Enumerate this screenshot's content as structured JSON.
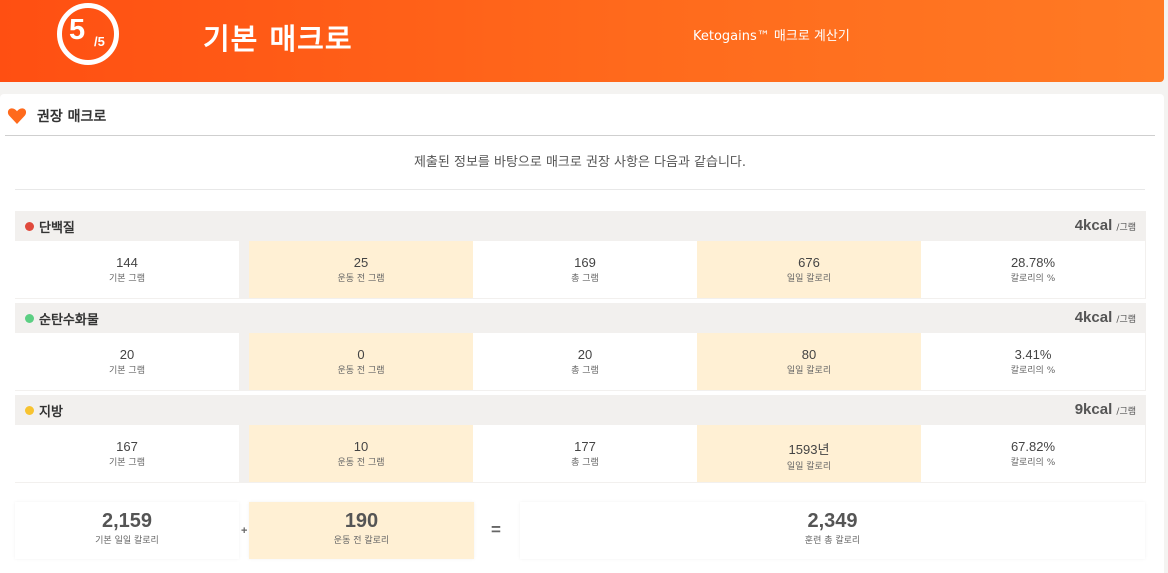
{
  "header": {
    "step_current": "5",
    "step_total": "/5",
    "title": "기본 매크로",
    "subtitle": "Ketogains™ 매크로 계산기",
    "gradient_colors": [
      "#ff4f12",
      "#ff7a24"
    ]
  },
  "section": {
    "icon": "heart-icon",
    "title": "권장 매크로",
    "intro": "제출된 정보를 바탕으로 매크로 권장 사항은 다음과 같습니다."
  },
  "groups": [
    {
      "name": "단백질",
      "color": "#e04a3c",
      "kcal_value": "4kcal",
      "kcal_unit": "/그램",
      "cells": [
        {
          "value": "144",
          "label": "기본 그램"
        },
        {
          "value": "25",
          "label": "운동 전 그램"
        },
        {
          "value": "169",
          "label": "총 그램"
        },
        {
          "value": "676",
          "label": "일일 칼로리"
        },
        {
          "value": "28.78%",
          "label": "칼로리의 %"
        }
      ]
    },
    {
      "name": "순탄수화물",
      "color": "#5ccf83",
      "kcal_value": "4kcal",
      "kcal_unit": "/그램",
      "cells": [
        {
          "value": "20",
          "label": "기본 그램"
        },
        {
          "value": "0",
          "label": "운동 전 그램"
        },
        {
          "value": "20",
          "label": "총 그램"
        },
        {
          "value": "80",
          "label": "일일 칼로리"
        },
        {
          "value": "3.41%",
          "label": "칼로리의 %"
        }
      ]
    },
    {
      "name": "지방",
      "color": "#f7c330",
      "kcal_value": "9kcal",
      "kcal_unit": "/그램",
      "cells": [
        {
          "value": "167",
          "label": "기본 그램"
        },
        {
          "value": "10",
          "label": "운동 전 그램"
        },
        {
          "value": "177",
          "label": "총 그램"
        },
        {
          "value": "1593년",
          "label": "일일 칼로리"
        },
        {
          "value": "67.82%",
          "label": "칼로리의 %"
        }
      ]
    }
  ],
  "summary": {
    "base": {
      "value": "2,159",
      "label": "기본 일일 칼로리"
    },
    "plus": "+",
    "preworkout": {
      "value": "190",
      "label": "운동 전 칼로리"
    },
    "equals": "=",
    "total": {
      "value": "2,349",
      "label": "훈련 총 칼로리"
    }
  },
  "colors": {
    "accent": "#ff5a16",
    "highlight_cell": "#fff0d4",
    "group_background": "#f2f0ee"
  }
}
